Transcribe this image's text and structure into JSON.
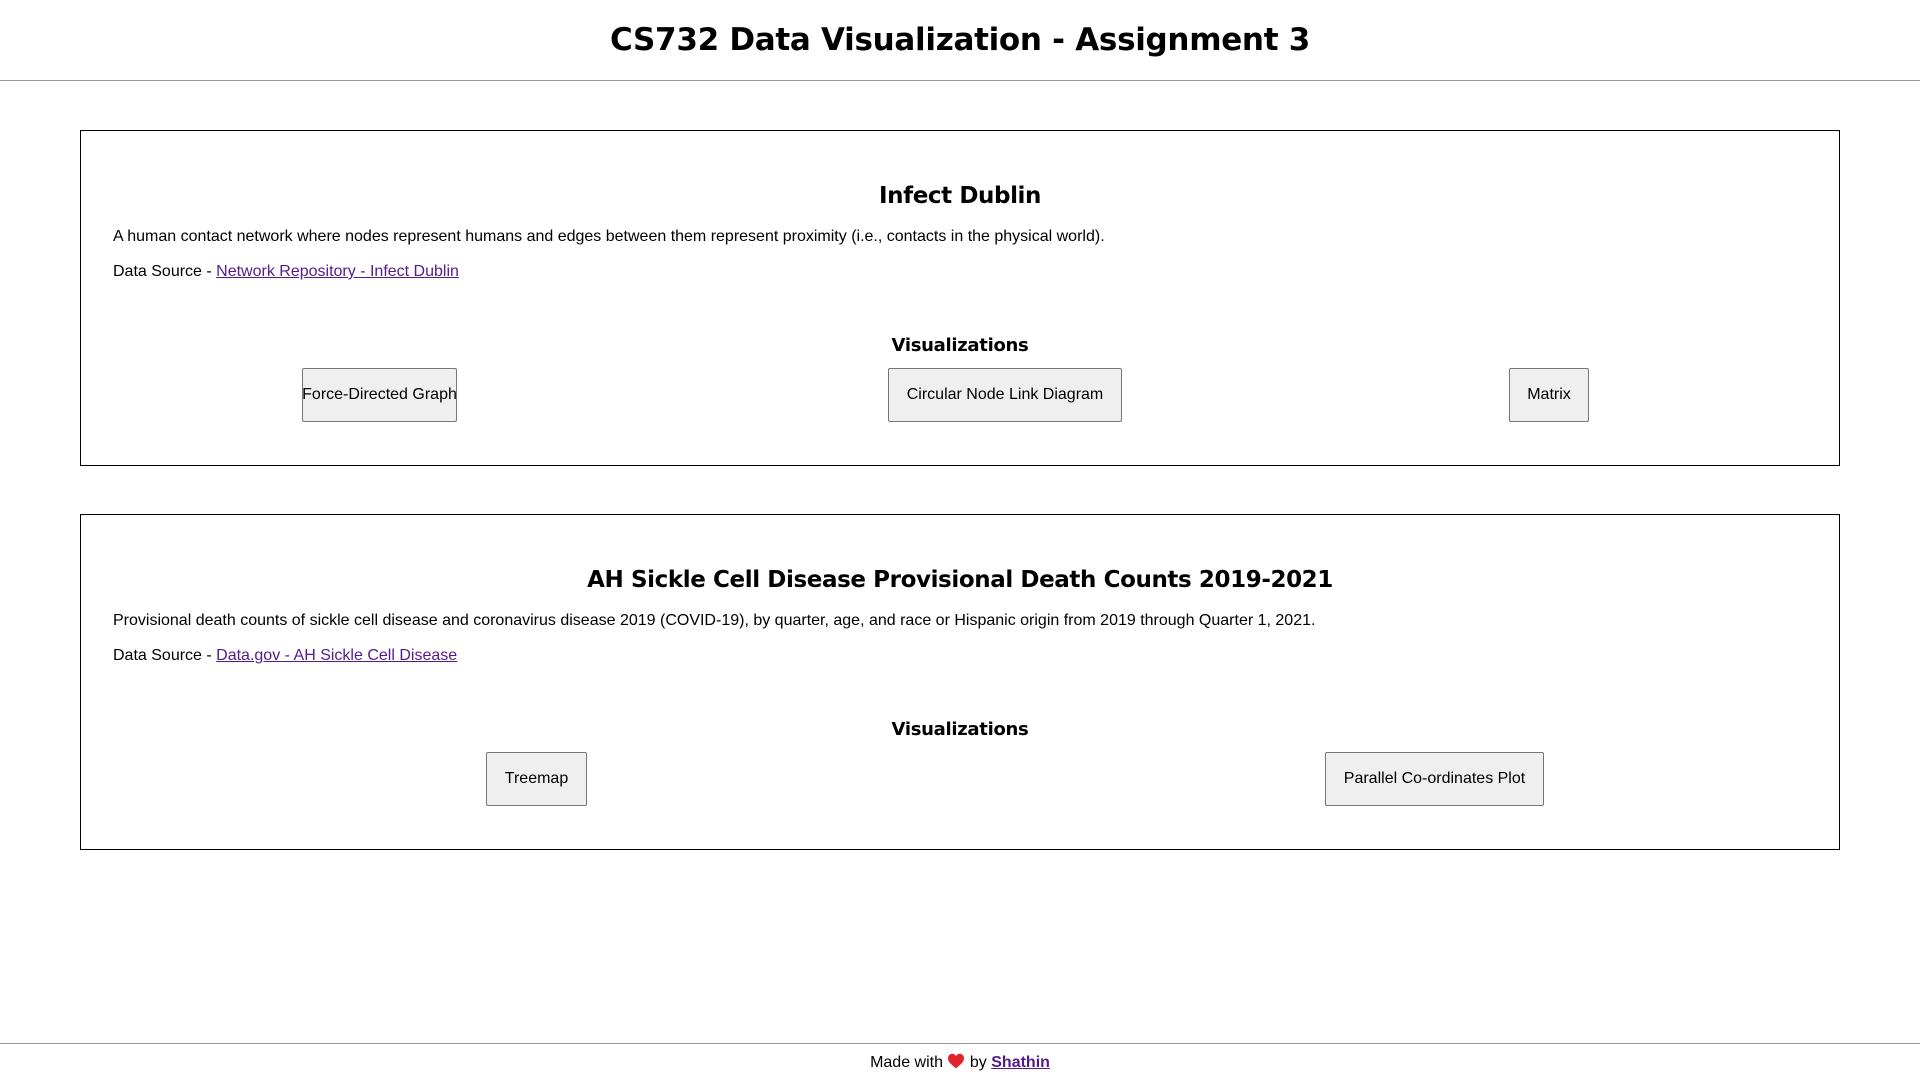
{
  "header": {
    "title": "CS732 Data Visualization - Assignment 3"
  },
  "sections": [
    {
      "title": "Infect Dublin",
      "description": "A human contact network where nodes represent humans and edges between them represent proximity (i.e., contacts in the physical world).",
      "source_prefix": "Data Source - ",
      "source_link": "Network Repository - Infect Dublin",
      "visualizations_heading": "Visualizations",
      "buttons": [
        "Force-Directed Graph",
        "Circular Node Link Diagram",
        "Matrix"
      ]
    },
    {
      "title": "AH Sickle Cell Disease Provisional Death Counts 2019-2021",
      "description": "Provisional death counts of sickle cell disease and coronavirus disease 2019 (COVID-19), by quarter, age, and race or Hispanic origin from 2019 through Quarter 1, 2021.",
      "source_prefix": "Data Source - ",
      "source_link": "Data.gov - AH Sickle Cell Disease",
      "visualizations_heading": "Visualizations",
      "buttons": [
        "Treemap",
        "Parallel Co-ordinates Plot"
      ]
    }
  ],
  "footer": {
    "made_with": "Made with",
    "heart_icon": "red-heart-icon",
    "by": "by",
    "author": "Shathin"
  },
  "colors": {
    "link_visited": "#551a8b",
    "button_bg": "#efefef",
    "heart": "#e0242c"
  }
}
